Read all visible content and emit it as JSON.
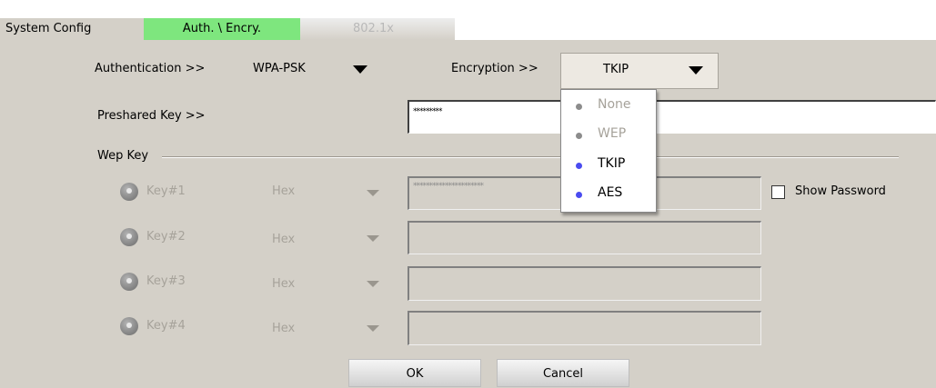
{
  "tabs": [
    {
      "label": "System Config"
    },
    {
      "label": "Auth. \\ Encry."
    },
    {
      "label": "802.1x"
    }
  ],
  "auth": {
    "label": "Authentication >>",
    "value": "WPA-PSK"
  },
  "encryption": {
    "label": "Encryption >>",
    "value": "TKIP",
    "options": [
      {
        "label": "None",
        "enabled": false
      },
      {
        "label": "WEP",
        "enabled": false
      },
      {
        "label": "TKIP",
        "enabled": true
      },
      {
        "label": "AES",
        "enabled": true
      }
    ]
  },
  "preshared": {
    "label": "Preshared Key >>",
    "value": "*********"
  },
  "wep": {
    "group_label": "Wep Key",
    "keys": [
      {
        "label": "Key#1",
        "format": "Hex",
        "value": "**********************"
      },
      {
        "label": "Key#2",
        "format": "Hex",
        "value": ""
      },
      {
        "label": "Key#3",
        "format": "Hex",
        "value": ""
      },
      {
        "label": "Key#4",
        "format": "Hex",
        "value": ""
      }
    ]
  },
  "show_password": {
    "label": "Show Password",
    "checked": false
  },
  "buttons": {
    "ok": "OK",
    "cancel": "Cancel"
  },
  "colors": {
    "active_tab": "#7ee67e",
    "background": "#d4d0c8",
    "enabled_dot": "#4a4cf0",
    "disabled_dot": "#8c8c8c"
  }
}
